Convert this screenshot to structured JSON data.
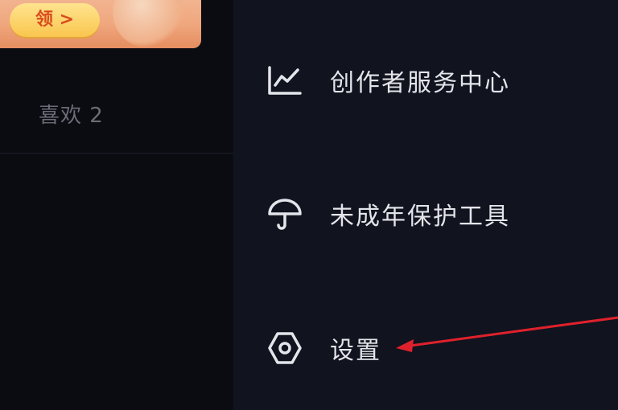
{
  "left": {
    "banner_button_label": "领 >",
    "likes_label": "喜欢 2"
  },
  "drawer": {
    "items": [
      {
        "label": "创作者服务中心",
        "icon": "trending-chart-icon"
      },
      {
        "label": "未成年保护工具",
        "icon": "umbrella-icon"
      },
      {
        "label": "设置",
        "icon": "hexagon-settings-icon"
      }
    ]
  },
  "colors": {
    "background": "#0d0e14",
    "drawer_background": "#11131f",
    "menu_text": "#e4e5ea",
    "muted_text": "#6a6d76",
    "banner": "#f0a77e",
    "annotation_arrow": "#e0212b"
  }
}
